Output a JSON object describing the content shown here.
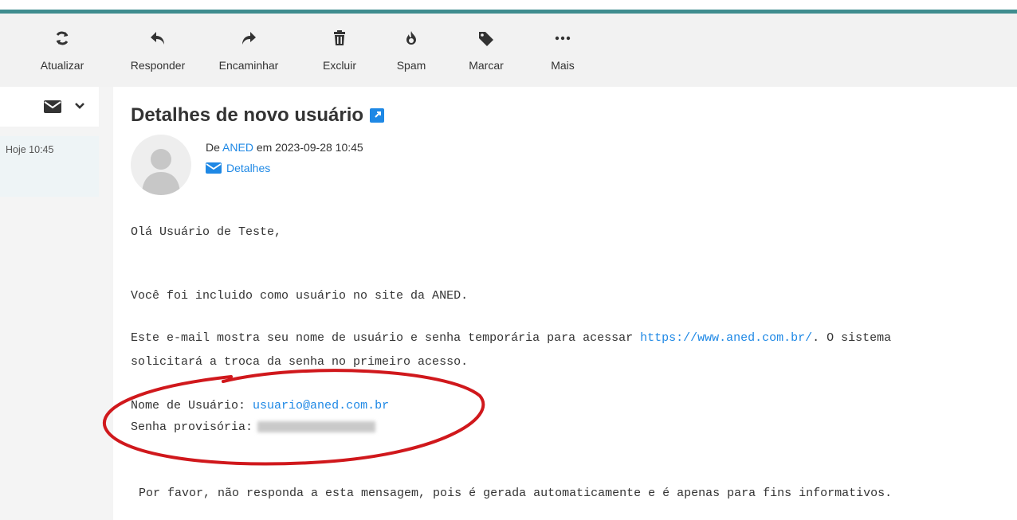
{
  "toolbar": {
    "refresh_label": "Atualizar",
    "reply_label": "Responder",
    "forward_label": "Encaminhar",
    "delete_label": "Excluir",
    "spam_label": "Spam",
    "tag_label": "Marcar",
    "more_label": "Mais"
  },
  "message_list": {
    "item_date": "Hoje 10:45"
  },
  "message": {
    "subject": "Detalhes de novo usuário",
    "from_prefix": "De",
    "from_name": "ANED",
    "date_prefix": "em",
    "date": "2023-09-28 10:45",
    "details_label": "Detalhes",
    "body": {
      "greeting": "Olá Usuário de Teste,",
      "p1": "Você foi incluido como usuário no site da ANED.",
      "p2_a": "Este e-mail mostra seu nome de usuário e senha temporária para acessar",
      "p2_link": "https://www.aned.com.br/",
      "p2_b": ". O sistema",
      "p2_c": "solicitará a troca da senha no primeiro acesso.",
      "username_label": "Nome de Usuário:",
      "username_value": "usuario@aned.com.br",
      "password_label": "Senha provisória:",
      "footer": "Por favor, não responda a esta mensagem, pois é gerada automaticamente e é apenas para fins informativos."
    }
  },
  "colors": {
    "accent": "#1e88e5",
    "teal_bar": "#3f8d8f",
    "annotation_red": "#d0181c"
  }
}
